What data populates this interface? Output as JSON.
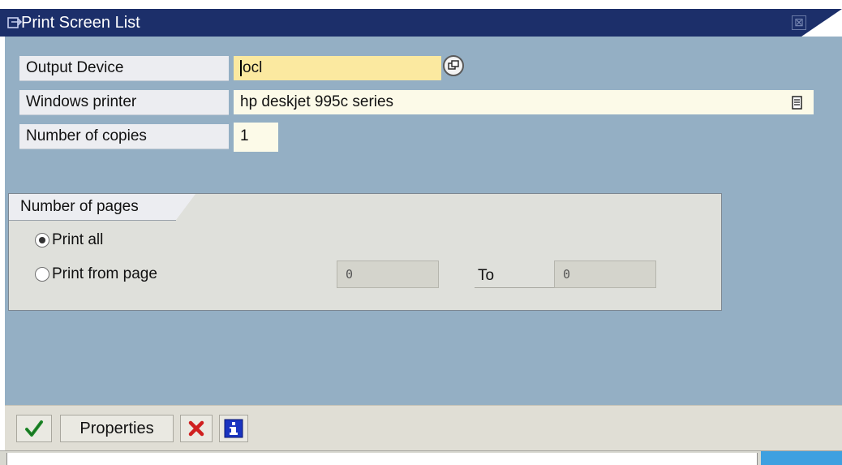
{
  "window": {
    "title": "Print Screen List",
    "close_glyph": "⊠"
  },
  "form": {
    "output_device": {
      "label": "Output Device",
      "value": "ocl"
    },
    "windows_printer": {
      "label": "Windows printer",
      "value": "hp deskjet 995c series"
    },
    "number_of_copies": {
      "label": "Number of copies",
      "value": "1"
    }
  },
  "pages_group": {
    "title": "Number of pages",
    "print_all_label": "Print all",
    "print_all_checked": true,
    "print_from_label": "Print from page",
    "from_value": "0",
    "to_label": "To",
    "to_value": "0"
  },
  "toolbar": {
    "properties_label": "Properties"
  },
  "icons": {
    "confirm": "check-icon",
    "cancel": "cancel-x-icon",
    "info": "info-icon",
    "match": "possible-entries-icon",
    "doc": "document-icon",
    "title": "window-icon"
  },
  "colors": {
    "titlebar": "#1c2f6a",
    "background": "#94afc4",
    "required_field": "#fbe9a0",
    "input_field": "#fcfae8",
    "confirm_green": "#1f8c2a",
    "cancel_red": "#d02020",
    "info_blue": "#1a34c0",
    "status_accent": "#3ea0e0"
  }
}
